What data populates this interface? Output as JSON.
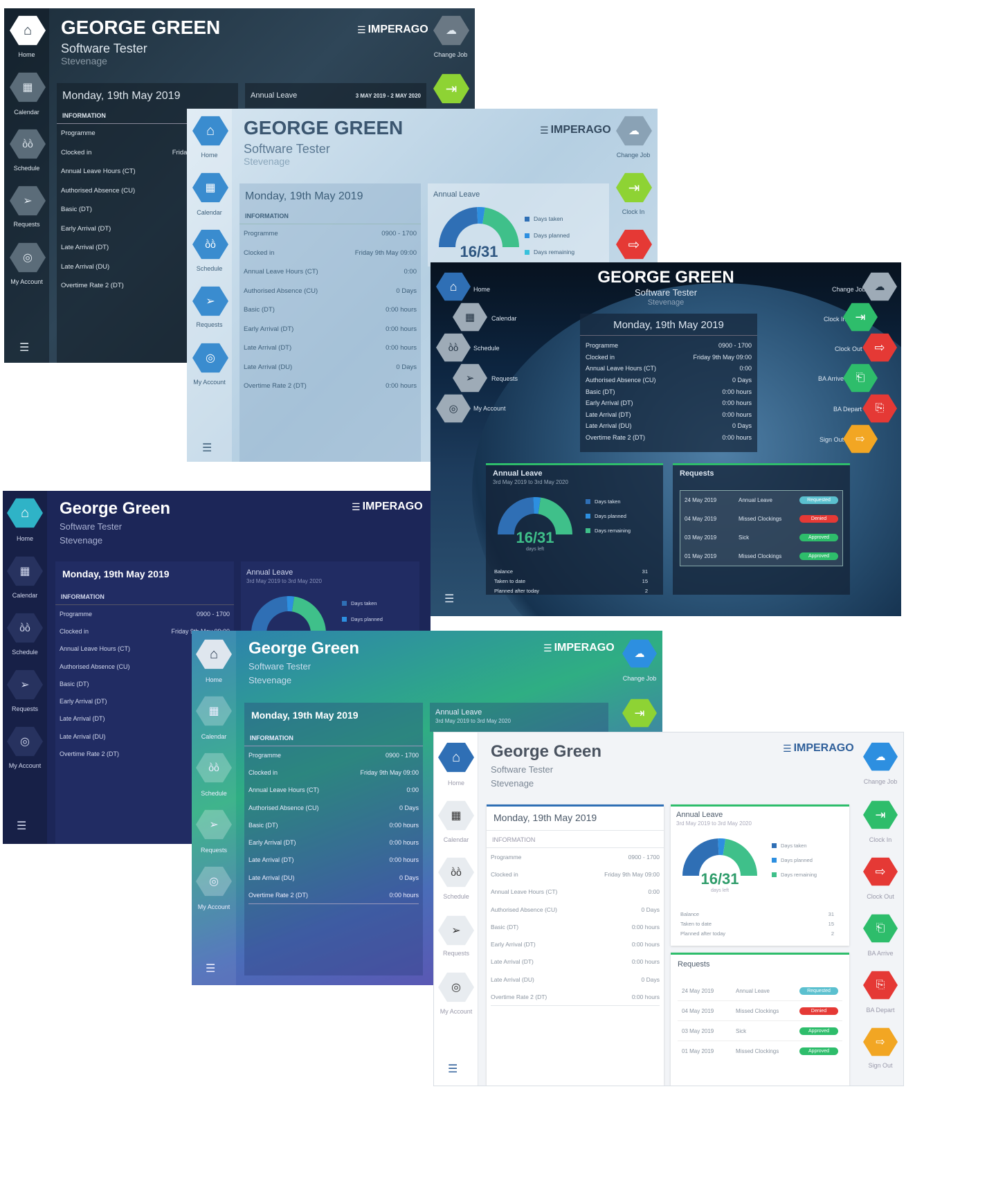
{
  "brand": "IMPERAGO",
  "user": {
    "name_caps": "GEORGE GREEN",
    "name": "George Green",
    "role": "Software Tester",
    "location": "Stevenage"
  },
  "nav": {
    "home": "Home",
    "calendar": "Calendar",
    "schedule": "Schedule",
    "requests": "Requests",
    "my_account": "My Account"
  },
  "actions": {
    "change_job": "Change Job",
    "clock_in": "Clock In",
    "clock_out": "Clock Out",
    "ba_arrive": "BA Arrive",
    "ba_depart": "BA Depart",
    "sign_out": "Sign Out"
  },
  "date_label": "Monday, 19th May 2019",
  "info_heading": "INFORMATION",
  "info_rows": [
    {
      "label": "Programme",
      "value": "0900 - 1700"
    },
    {
      "label": "Clocked in",
      "value": "Friday 9th May 09:00"
    },
    {
      "label": "Annual Leave Hours (CT)",
      "value": "0:00"
    },
    {
      "label": "Authorised Absence (CU)",
      "value": "0 Days"
    },
    {
      "label": "Basic (DT)",
      "value": "0:00 hours"
    },
    {
      "label": "Early Arrival (DT)",
      "value": "0:00 hours"
    },
    {
      "label": "Late Arrival (DT)",
      "value": "0:00 hours"
    },
    {
      "label": "Late Arrival (DU)",
      "value": "0 Days"
    },
    {
      "label": "Overtime Rate 2 (DT)",
      "value": "0:00 hours"
    }
  ],
  "annual_leave": {
    "title": "Annual Leave",
    "range_caps": "3 MAY 2019 - 2 MAY 2020",
    "range": "3rd May 2019 to 3rd May 2020",
    "counter": "16/31",
    "counter_sub": "days left",
    "legend": [
      "Days taken",
      "Days planned",
      "Days remaining"
    ],
    "stats": [
      {
        "label": "Balance",
        "value": "31"
      },
      {
        "label": "Taken to date",
        "value": "15"
      },
      {
        "label": "Planned after today",
        "value": "2"
      }
    ]
  },
  "chart_data": {
    "type": "pie",
    "title": "Annual Leave",
    "categories": [
      "Days taken",
      "Days planned",
      "Days remaining"
    ],
    "values": [
      15,
      2,
      14
    ],
    "total": 31,
    "colors": [
      "#2f6fb5",
      "#2d8fe0",
      "#3fc08a"
    ]
  },
  "requests": {
    "title": "Requests",
    "items": [
      {
        "date": "24 May 2019",
        "type": "Annual Leave",
        "status": "Requested",
        "color": "#5bc0cf"
      },
      {
        "date": "04 May 2019",
        "type": "Missed Clockings",
        "status": "Denied",
        "color": "#e53935"
      },
      {
        "date": "03 May 2019",
        "type": "Sick",
        "status": "Approved",
        "color": "#2ebd6b"
      },
      {
        "date": "01 May 2019",
        "type": "Missed Clockings",
        "status": "Approved",
        "color": "#2ebd6b"
      }
    ]
  },
  "colors": {
    "teal": "#2fb3c7",
    "green_action": "#8ed334",
    "red_action": "#e53935",
    "orange_action": "#f2a623",
    "navy": "#1c2658"
  }
}
